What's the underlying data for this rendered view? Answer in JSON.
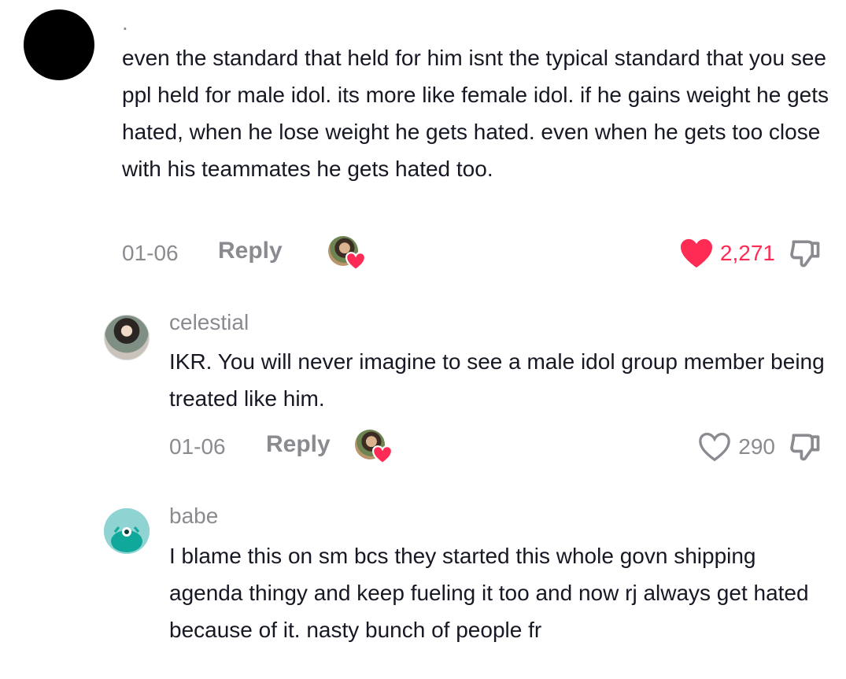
{
  "comments": [
    {
      "username": ".",
      "text": "even the standard that held for him isnt the typical standard that you see ppl held for male idol. its more like female idol. if he gains weight he gets hated, when he lose weight he gets hated. even when he gets too close with his teammates he gets hated too.",
      "date": "01-06",
      "reply_label": "Reply",
      "likes": "2,271",
      "liked": true,
      "like_color": "#fe2c55"
    },
    {
      "username": "celestial",
      "text": "IKR. You will never imagine to see a male idol group member being treated like him.",
      "date": "01-06",
      "reply_label": "Reply",
      "likes": "290",
      "liked": false
    },
    {
      "username": "babe",
      "text": "I blame this on sm bcs they started this whole govn shipping agenda thingy and keep fueling it too and now rj always get hated because of it. nasty bunch of people fr"
    }
  ],
  "icons": {
    "heart": "heart-icon",
    "dislike": "thumbs-down-icon",
    "creator_like": "creator-liked-badge"
  },
  "colors": {
    "meta_text": "#8a8b91",
    "body_text": "#161823",
    "heart_red": "#fe2c55"
  }
}
